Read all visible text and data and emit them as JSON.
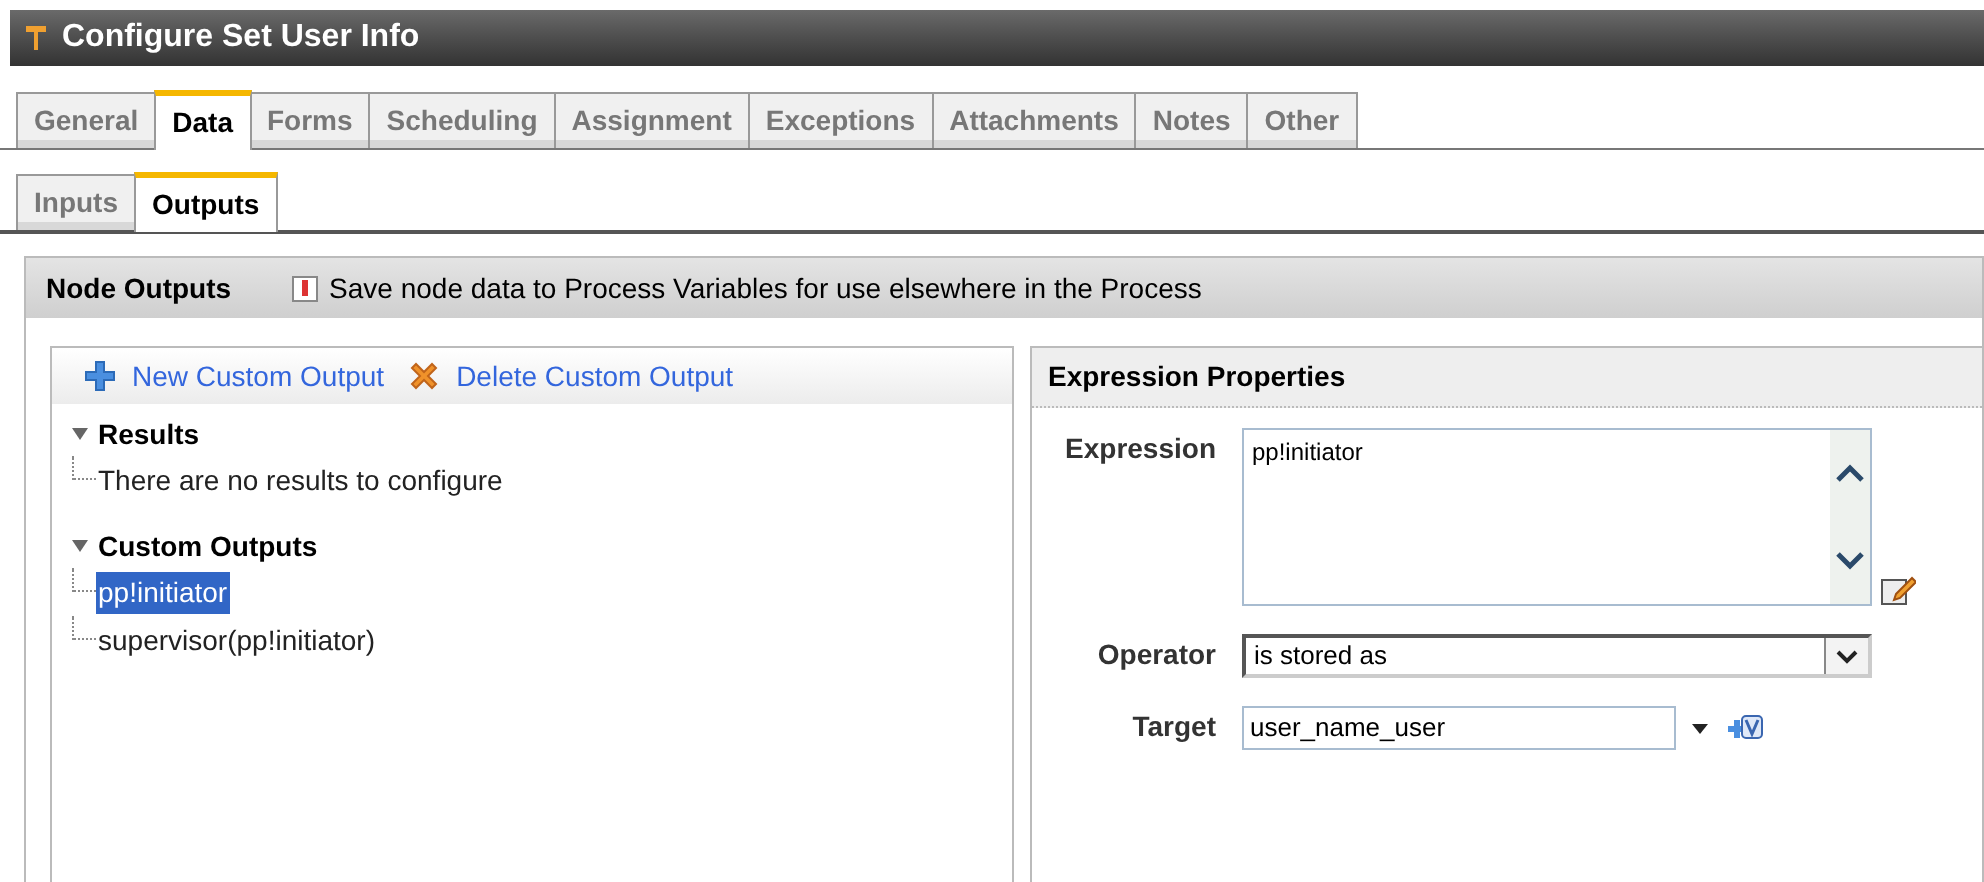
{
  "window": {
    "title": "Configure Set User Info"
  },
  "tabs": [
    {
      "label": "General",
      "selected": false
    },
    {
      "label": "Data",
      "selected": true
    },
    {
      "label": "Forms",
      "selected": false
    },
    {
      "label": "Scheduling",
      "selected": false
    },
    {
      "label": "Assignment",
      "selected": false
    },
    {
      "label": "Exceptions",
      "selected": false
    },
    {
      "label": "Attachments",
      "selected": false
    },
    {
      "label": "Notes",
      "selected": false
    },
    {
      "label": "Other",
      "selected": false
    }
  ],
  "subtabs": [
    {
      "label": "Inputs",
      "selected": false
    },
    {
      "label": "Outputs",
      "selected": true
    }
  ],
  "panel": {
    "title": "Node Outputs",
    "info": "Save node data to Process Variables for use elsewhere in the Process"
  },
  "toolbar": [
    {
      "label": "New Custom Output",
      "kind": "add"
    },
    {
      "label": "Delete Custom Output",
      "kind": "delete"
    }
  ],
  "tree": [
    {
      "label": "Results",
      "expanded": true,
      "children": [
        {
          "label": "There are no results to configure",
          "selected": false
        }
      ]
    },
    {
      "label": "Custom Outputs",
      "expanded": true,
      "children": [
        {
          "label": "pp!initiator",
          "selected": true
        },
        {
          "label": "supervisor(pp!initiator)",
          "selected": false
        }
      ]
    }
  ],
  "properties": {
    "title": "Expression Properties",
    "expression": {
      "label": "Expression",
      "value": "pp!initiator"
    },
    "operator": {
      "label": "Operator",
      "value": "is stored as"
    },
    "target": {
      "label": "Target",
      "value": "user_name_user"
    }
  }
}
